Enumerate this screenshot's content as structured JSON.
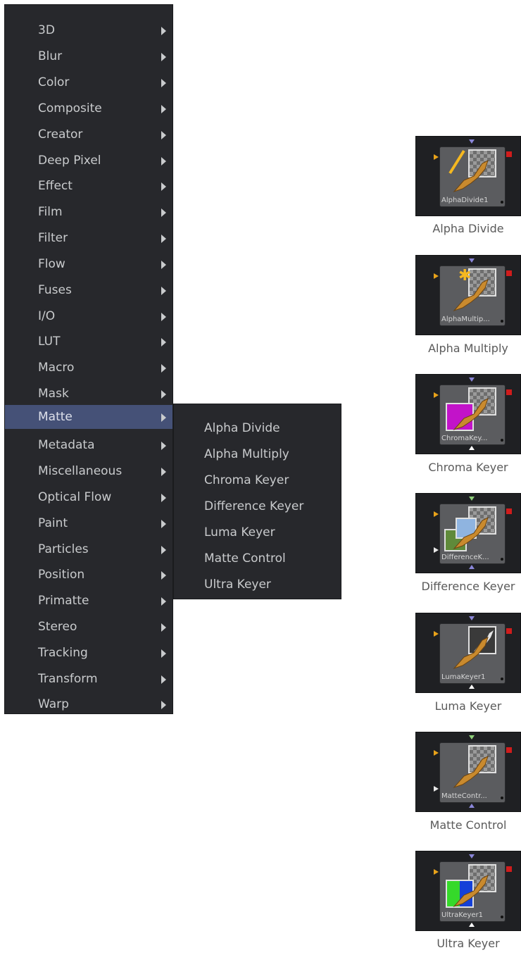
{
  "menu": {
    "items": [
      {
        "label": "3D"
      },
      {
        "label": "Blur"
      },
      {
        "label": "Color"
      },
      {
        "label": "Composite"
      },
      {
        "label": "Creator"
      },
      {
        "label": "Deep Pixel"
      },
      {
        "label": "Effect"
      },
      {
        "label": "Film"
      },
      {
        "label": "Filter"
      },
      {
        "label": "Flow"
      },
      {
        "label": "Fuses"
      },
      {
        "label": "I/O"
      },
      {
        "label": "LUT"
      },
      {
        "label": "Macro"
      },
      {
        "label": "Mask"
      },
      {
        "label": "Matte",
        "active": true
      },
      {
        "label": "Metadata"
      },
      {
        "label": "Miscellaneous"
      },
      {
        "label": "Optical Flow"
      },
      {
        "label": "Paint"
      },
      {
        "label": "Particles"
      },
      {
        "label": "Position"
      },
      {
        "label": "Primatte"
      },
      {
        "label": "Stereo"
      },
      {
        "label": "Tracking"
      },
      {
        "label": "Transform"
      },
      {
        "label": "Warp"
      }
    ],
    "arrow_icon": "submenu-arrow-icon",
    "colors": {
      "background": "#27282c",
      "highlight": "#455177",
      "text": "#c9cbcd"
    }
  },
  "submenu": {
    "items": [
      {
        "label": "Alpha Divide"
      },
      {
        "label": "Alpha Multiply"
      },
      {
        "label": "Chroma Keyer"
      },
      {
        "label": "Difference Keyer"
      },
      {
        "label": "Luma Keyer"
      },
      {
        "label": "Matte Control"
      },
      {
        "label": "Ultra Keyer"
      }
    ]
  },
  "nodes": [
    {
      "node_name": "AlphaDivide1",
      "caption": "Alpha Divide",
      "overlay": "slash",
      "swatch": ""
    },
    {
      "node_name": "AlphaMultip...",
      "caption": "Alpha Multiply",
      "overlay": "asterisk",
      "swatch": ""
    },
    {
      "node_name": "ChromaKey...",
      "caption": "Chroma Keyer",
      "overlay": "",
      "swatch": "chroma"
    },
    {
      "node_name": "DifferenceK...",
      "caption": "Difference Keyer",
      "overlay": "",
      "swatch": "difference"
    },
    {
      "node_name": "LumaKeyer1",
      "caption": "Luma Keyer",
      "overlay": "",
      "swatch": "luma"
    },
    {
      "node_name": "MatteContr...",
      "caption": "Matte Control",
      "overlay": "",
      "swatch": ""
    },
    {
      "node_name": "UltraKeyer1",
      "caption": "Ultra Keyer",
      "overlay": "",
      "swatch": "ultra"
    }
  ],
  "node_colors": {
    "input": "#e8a21a",
    "output": "#d01c1c",
    "effect_mask": "#8a86d9",
    "tile_bg": "#1f2023",
    "node_body": "#5b5c5f"
  }
}
